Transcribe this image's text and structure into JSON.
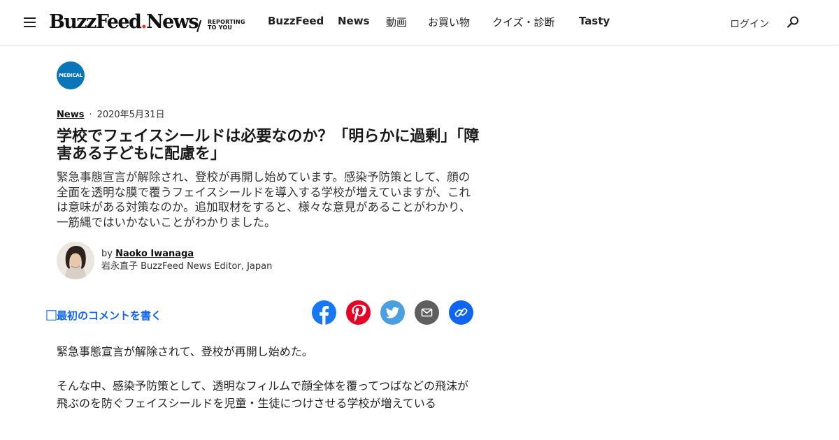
{
  "header": {
    "logo_main": "BuzzFeed",
    "logo_dot": ".",
    "logo_news": "News",
    "tagline_slash": "/",
    "tagline_line1": "REPORTING",
    "tagline_line2": "TO YOU",
    "nav": [
      "BuzzFeed",
      "News",
      "動画",
      "お買い物",
      "クイズ・診断",
      "Tasty"
    ],
    "login": "ログイン"
  },
  "article": {
    "badge": "MEDICAL",
    "category": "News",
    "separator": "·",
    "date": "2020年5月31日",
    "title": "学校でフェイスシールドは必要なのか？「明らかに過剰」「障害ある子どもに配慮を」",
    "dek": "緊急事態宣言が解除され、登校が再開し始めています。感染予防策として、顔の全面を透明な膜で覆うフェイスシールドを導入する学校が増えていますが、これは意味がある対策なのか。追加取材をすると、様々な意見があることがわかり、一筋縄ではいかないことがわかりました。",
    "by": "by",
    "author": "Naoko Iwanaga",
    "author_title": "岩永直子 BuzzFeed News Editor, Japan",
    "comment_link": "⃞最初のコメントを書く",
    "paragraphs": [
      "緊急事態宣言が解除されて、登校が再開し始めた。",
      "そんな中、感染予防策として、透明なフィルムで顔全体を覆ってつばなどの飛沫が飛ぶのを防ぐフェイスシールドを児童・生徒につけさせる学校が増えている"
    ]
  },
  "share_buttons": [
    {
      "icon": "facebook-icon",
      "color": "#1877f2"
    },
    {
      "icon": "pinterest-icon",
      "color": "#e60023"
    },
    {
      "icon": "twitter-icon",
      "color": "#4a9fe0"
    },
    {
      "icon": "mail-icon",
      "color": "#5f5f5f"
    },
    {
      "icon": "link-icon",
      "color": "#0f65ef"
    }
  ]
}
